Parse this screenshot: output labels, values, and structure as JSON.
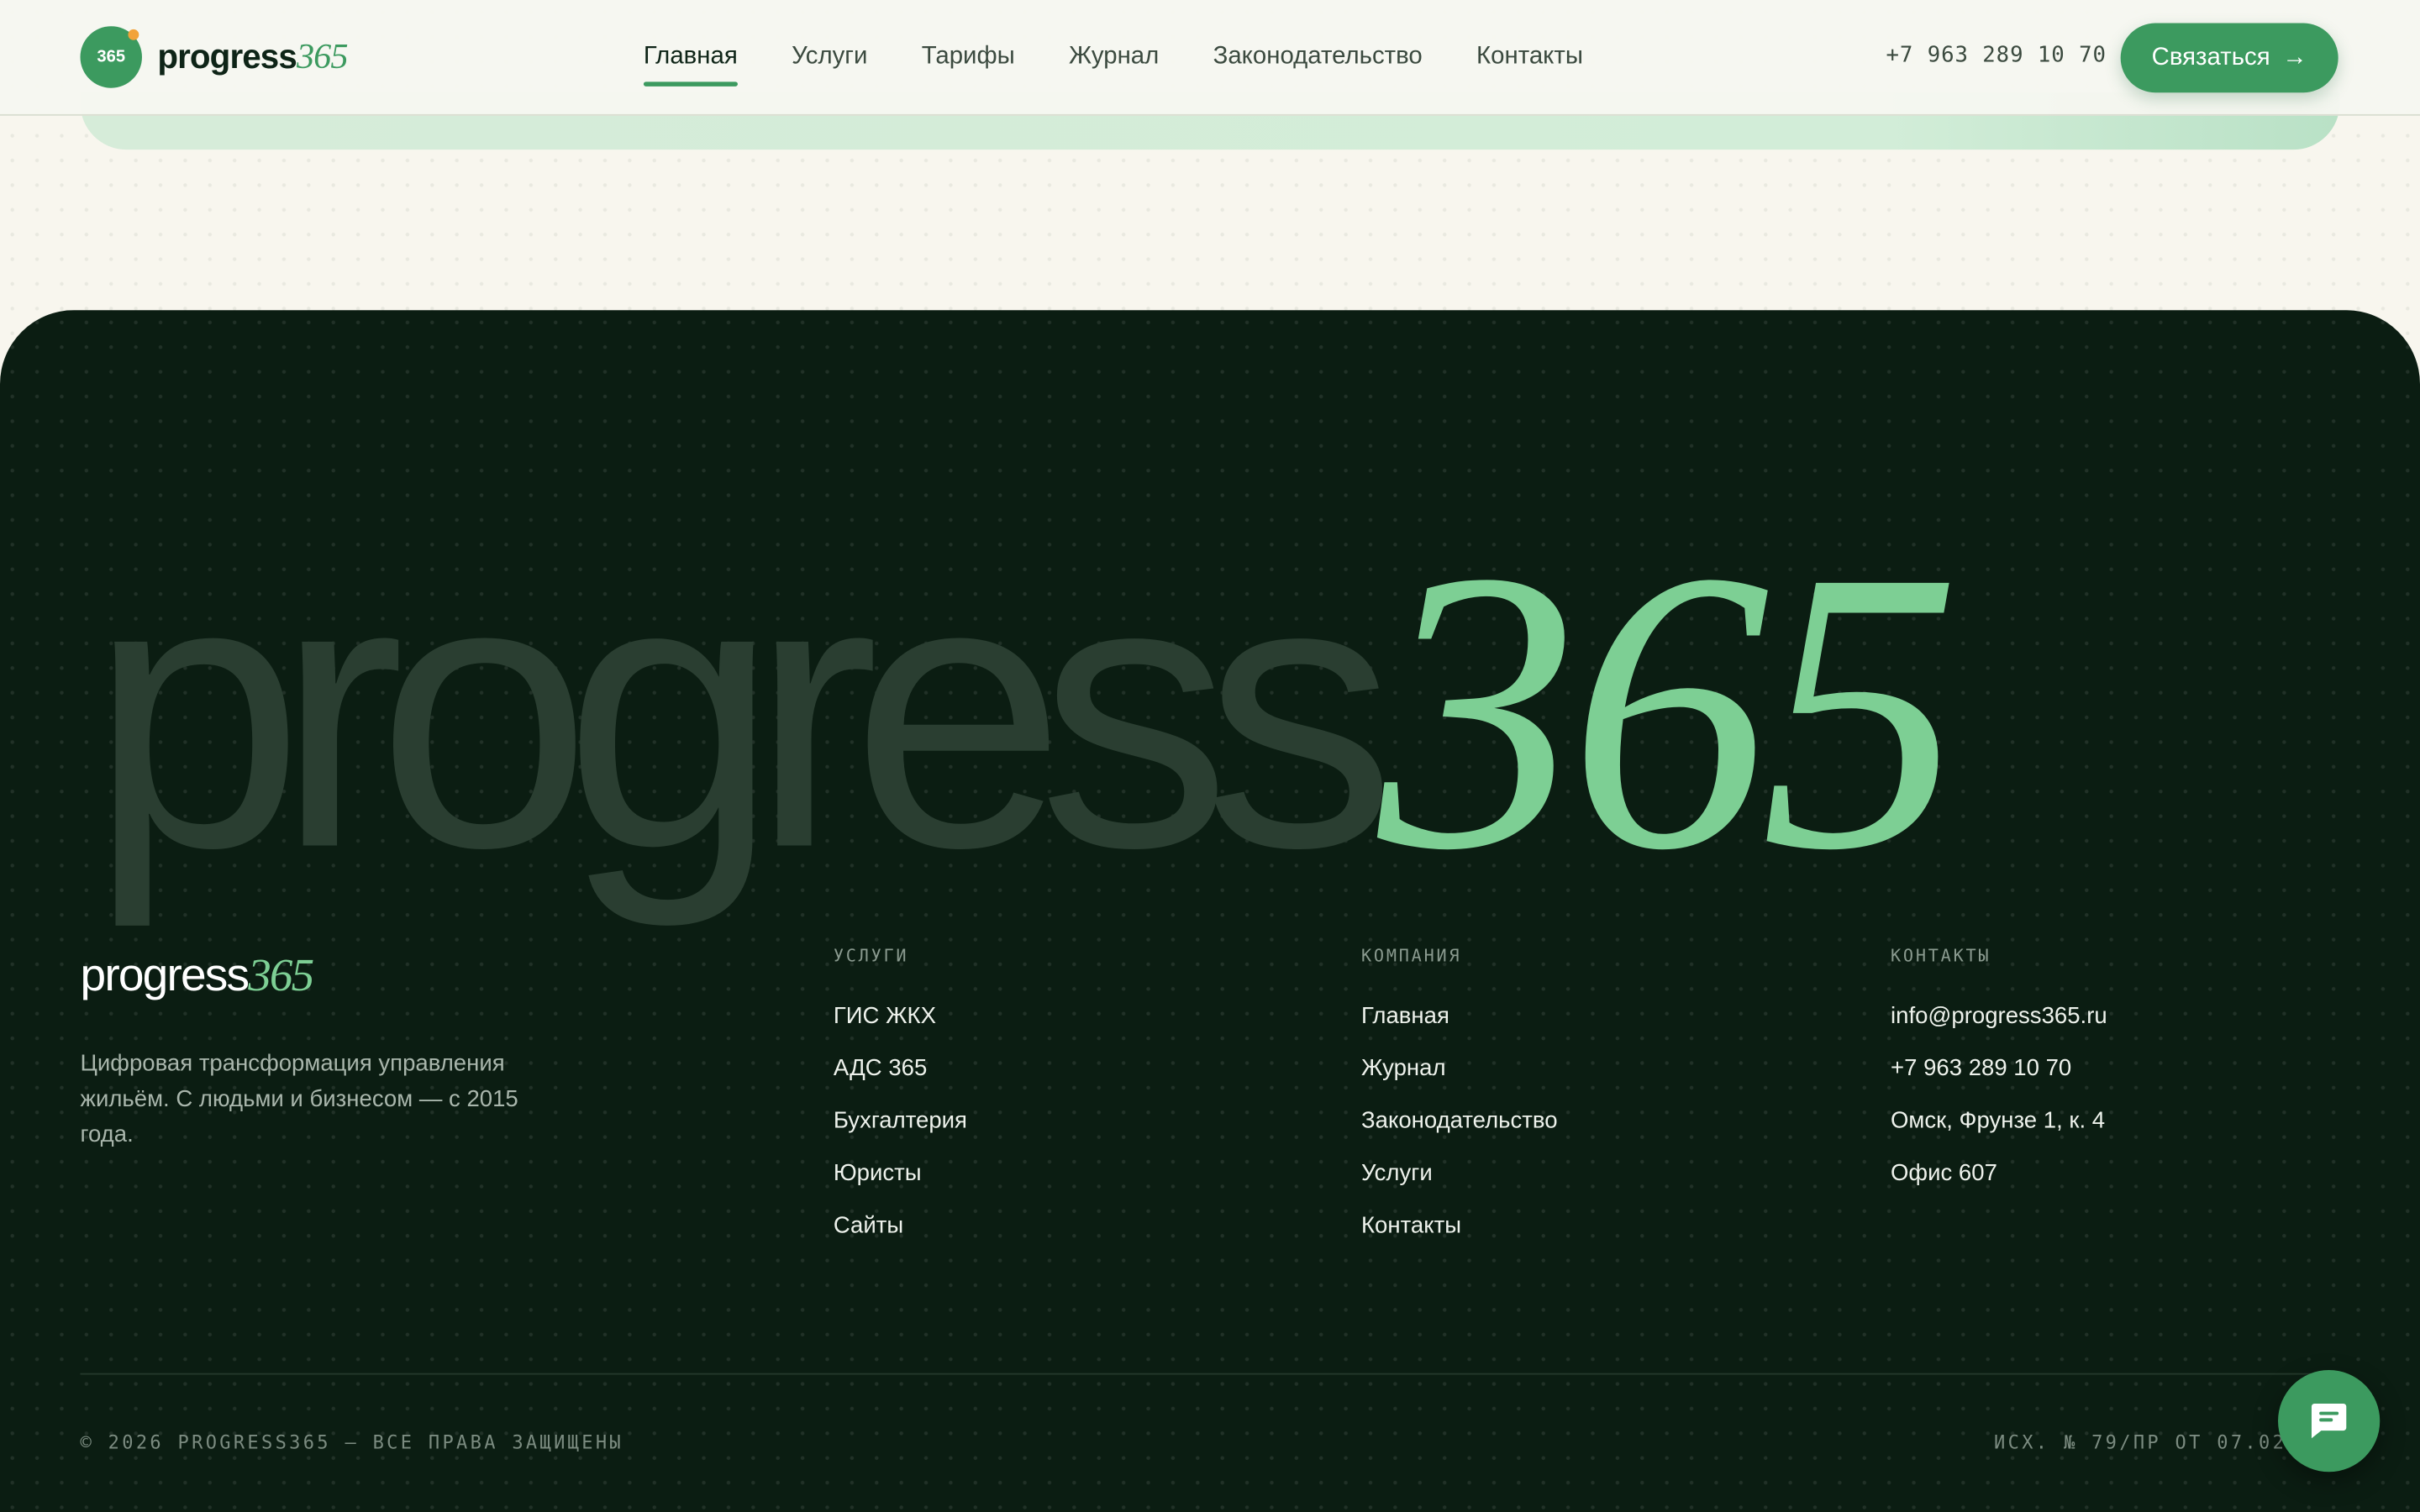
{
  "colors": {
    "accent": "#3c9a5f",
    "accent_light": "#7dcf94",
    "footer_bg": "#0b1d12",
    "page_bg": "#f8f6ee"
  },
  "header": {
    "logo": {
      "badge": "365",
      "word": "progress",
      "num": "365"
    },
    "nav": [
      {
        "label": "Главная",
        "active": true
      },
      {
        "label": "Услуги"
      },
      {
        "label": "Тарифы"
      },
      {
        "label": "Журнал"
      },
      {
        "label": "Законодательство"
      },
      {
        "label": "Контакты"
      }
    ],
    "phone": "+7 963 289 10 70",
    "cta_label": "Связаться",
    "cta_icon": "arrow-right-icon"
  },
  "footer": {
    "bigword": {
      "word": "progress",
      "num": "365"
    },
    "logo": {
      "word": "progress",
      "num": "365"
    },
    "description": "Цифровая трансформация управления жильём. С людьми и бизнесом — с 2015 года.",
    "columns": [
      {
        "heading": "УСЛУГИ",
        "links": [
          "ГИС ЖКХ",
          "АДС 365",
          "Бухгалтерия",
          "Юристы",
          "Сайты"
        ]
      },
      {
        "heading": "КОМПАНИЯ",
        "links": [
          "Главная",
          "Журнал",
          "Законодательство",
          "Услуги",
          "Контакты"
        ]
      },
      {
        "heading": "КОНТАКТЫ",
        "links": [
          "info@progress365.ru",
          "+7 963 289 10 70",
          "Омск, Фрунзе 1, к. 4",
          "Офис 607"
        ]
      }
    ],
    "copyright": "© 2026 PROGRESS365 — ВСЕ ПРАВА ЗАЩИЩЕНЫ",
    "reference": "ИСХ. № 79/ПР ОТ 07.02."
  },
  "chat_icon": "chat-bubble-icon"
}
